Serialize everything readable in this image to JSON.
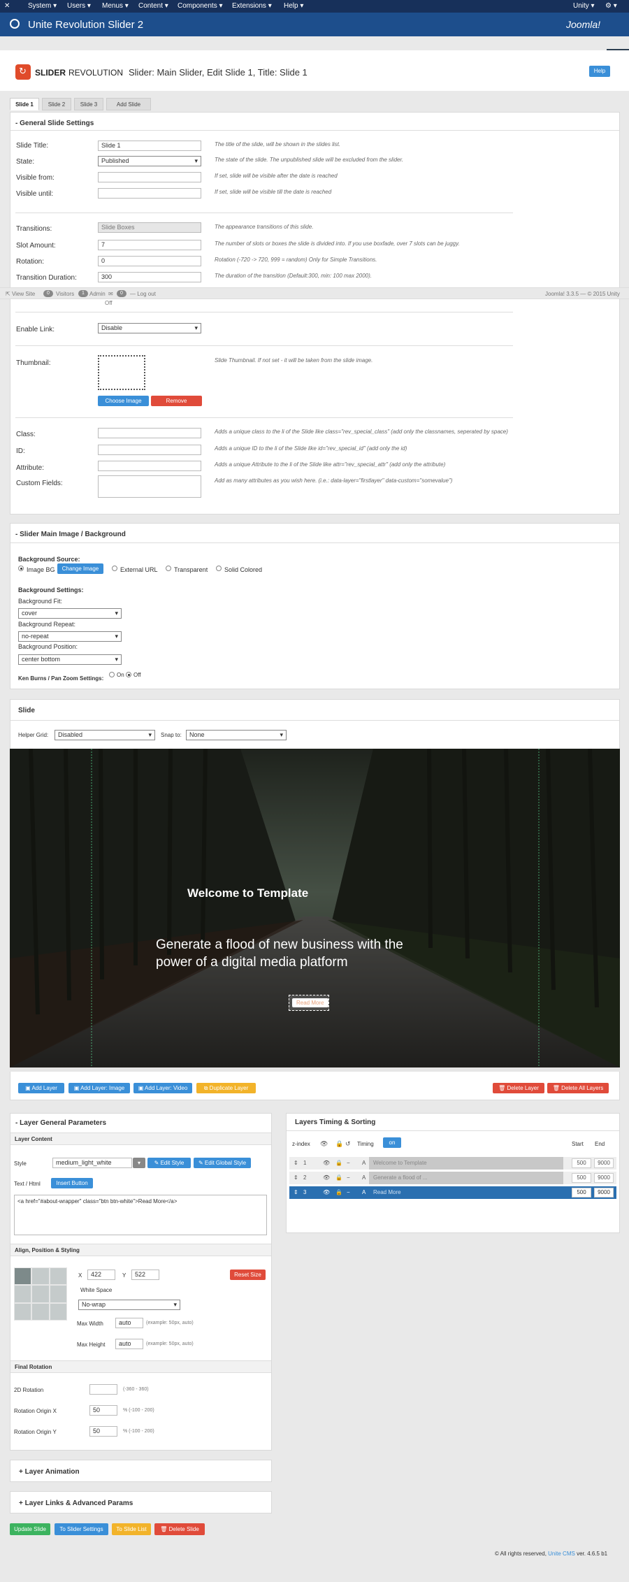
{
  "topbar": {
    "menu": [
      "System ▾",
      "Users ▾",
      "Menus ▾",
      "Content ▾",
      "Components ▾",
      "Extensions ▾",
      "Help ▾"
    ],
    "user": "Unity ▾",
    "settings": "⚙ ▾"
  },
  "titlebar": {
    "title": "Unite Revolution Slider 2",
    "brand": "Joomla!"
  },
  "header": {
    "logo_main": "SLIDER",
    "logo_sub": "REVOLUTION",
    "crumb": "Slider: Main Slider, Edit Slide 1, Title: Slide 1",
    "help": "Help"
  },
  "tabs": [
    "Slide 1",
    "Slide 2",
    "Slide 3",
    "Add Slide"
  ],
  "general": {
    "title": "General Slide Settings",
    "slide_title_label": "Slide Title:",
    "slide_title_value": "Slide 1",
    "slide_title_hint": "The title of the slide, will be shown in the slides list.",
    "state_label": "State:",
    "state_value": "Published",
    "state_hint": "The state of the slide. The unpublished slide will be excluded from the slider.",
    "visible_from_label": "Visible from:",
    "visible_from_hint": "If set, slide will be visible after the date is reached",
    "visible_until_label": "Visible until:",
    "visible_until_hint": "If set, slide will be visible till the date is reached",
    "transitions_label": "Transitions:",
    "transitions_value": "Slide Boxes",
    "transitions_hint": "The appearance transitions of this slide.",
    "slot_label": "Slot Amount:",
    "slot_value": "7",
    "slot_hint": "The number of slots or boxes the slide is divided into. If you use boxfade, over 7 slots can be juggy.",
    "rotation_label": "Rotation:",
    "rotation_value": "0",
    "rotation_hint": "Rotation (-720 -> 720, 999 = random) Only for Simple Transitions.",
    "duration_label": "Transition Duration:",
    "duration_value": "300",
    "duration_hint": "The duration of the transition (Default:300, min: 100 max 2000).",
    "off_label": "Off",
    "enable_link_label": "Enable Link:",
    "enable_link_value": "Disable",
    "thumbnail_label": "Thumbnail:",
    "thumbnail_hint": "Slide Thumbnail. If not set - it will be taken from the slide image.",
    "choose_image": "Choose Image",
    "remove": "Remove",
    "class_label": "Class:",
    "class_hint": "Adds a unique class to the li of the Slide like class=\"rev_special_class\" (add only the classnames, seperated by space)",
    "id_label": "ID:",
    "id_hint": "Adds a unique ID to the li of the Slide like id=\"rev_special_id\" (add only the id)",
    "attr_label": "Attribute:",
    "attr_hint": "Adds a unique Attribute to the li of the Slide like attr=\"rev_special_attr\" (add only the attribute)",
    "custom_label": "Custom Fields:",
    "custom_hint": "Add as many attributes as you wish here. (i.e.: data-layer=\"firstlayer\" data-custom=\"somevalue\")"
  },
  "statusbar": {
    "view_site": "View Site",
    "visitors_count": "0",
    "visitors": "Visitors",
    "admin_count": "1",
    "admin": "Admin",
    "msg_count": "0",
    "logout": "Log out",
    "version": "Joomla! 3.3.5 — © 2015 Unity"
  },
  "background": {
    "title": "Slider Main Image / Background",
    "source_label": "Background Source:",
    "image_bg": "Image BG",
    "change_image": "Change Image",
    "external_url": "External URL",
    "transparent": "Transparent",
    "solid": "Solid Colored",
    "settings_label": "Background Settings:",
    "fit_label": "Background Fit:",
    "fit_value": "cover",
    "repeat_label": "Background Repeat:",
    "repeat_value": "no-repeat",
    "position_label": "Background Position:",
    "position_value": "center bottom",
    "kenburns_label": "Ken Burns / Pan Zoom Settings:",
    "on": "On",
    "off": "Off"
  },
  "slide": {
    "title": "Slide",
    "helper_grid_label": "Helper Grid:",
    "helper_grid_value": "Disabled",
    "snap_label": "Snap to:",
    "snap_value": "None",
    "heading": "Welcome to Template",
    "body": "Generate a flood of new business with the power of a digital media platform",
    "button": "Read More"
  },
  "layer_buttons": {
    "add_layer": "Add Layer",
    "add_image": "Add Layer: Image",
    "add_video": "Add Layer: Video",
    "duplicate": "Duplicate Layer",
    "delete_layer": "Delete Layer",
    "delete_all": "Delete All Layers"
  },
  "params": {
    "title": "Layer General Parameters",
    "content_label": "Layer Content",
    "style_label": "Style",
    "style_value": "medium_light_white",
    "edit_style": "Edit Style",
    "edit_global": "Edit Global Style",
    "text_label": "Text / Html",
    "insert_button": "Insert Button",
    "html_value": "<a href=\"#about-wrapper\" class=\"btn btn-white\">Read More</a>",
    "align_label": "Align, Position & Styling",
    "x_label": "X",
    "x_value": "422",
    "y_label": "Y",
    "y_value": "522",
    "reset_size": "Reset Size",
    "white_space_label": "White Space",
    "white_space_value": "No-wrap",
    "max_width_label": "Max Width",
    "max_width_value": "auto",
    "max_width_hint": "(example: 50px, auto)",
    "max_height_label": "Max Height",
    "max_height_value": "auto",
    "max_height_hint": "(example: 50px, auto)",
    "final_rotation_label": "Final Rotation",
    "rot2d_label": "2D Rotation",
    "rot2d_hint": "(-360 - 360)",
    "origin_x_label": "Rotation Origin X",
    "origin_x_value": "50",
    "origin_x_hint": "% (-100 - 200)",
    "origin_y_label": "Rotation Origin Y",
    "origin_y_value": "50",
    "origin_y_hint": "% (-100 - 200)"
  },
  "timing": {
    "title": "Layers Timing & Sorting",
    "zindex": "z-index",
    "timing_label": "Timing",
    "timing_toggle": "on",
    "start": "Start",
    "end": "End",
    "rows": [
      {
        "idx": "1",
        "name": "Welcome to Template",
        "start": "500",
        "end": "9000"
      },
      {
        "idx": "2",
        "name": "Generate a flood of ...",
        "start": "500",
        "end": "9000"
      },
      {
        "idx": "3",
        "name": "Read More",
        "start": "500",
        "end": "9000"
      }
    ]
  },
  "collapsed": {
    "animation": "Layer Animation",
    "links": "Layer Links & Advanced Params"
  },
  "bottom_buttons": {
    "update": "Update Slide",
    "to_slider": "To Slider Settings",
    "to_list": "To Slide List",
    "delete": "Delete Slide"
  },
  "footer": {
    "prefix": "© All rights reserved,",
    "link": "Unite CMS",
    "suffix": "ver. 4.6.5 b1"
  }
}
